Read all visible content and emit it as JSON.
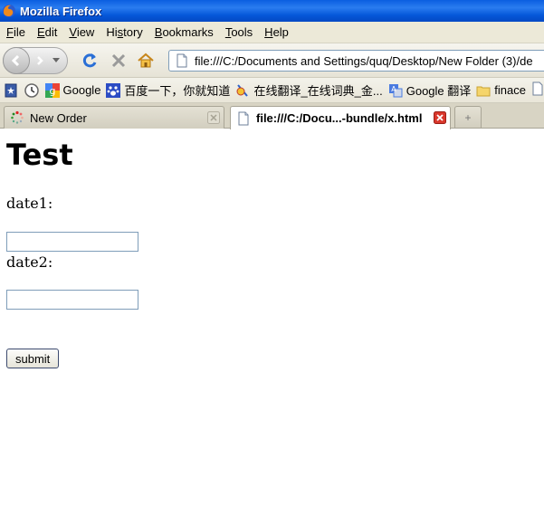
{
  "window": {
    "title": "Mozilla Firefox"
  },
  "menu": [
    "File",
    "Edit",
    "View",
    "History",
    "Bookmarks",
    "Tools",
    "Help"
  ],
  "menu_accel": [
    "F",
    "E",
    "V",
    "s",
    "B",
    "T",
    "H"
  ],
  "address_bar": {
    "url": "file:///C:/Documents and Settings/quq/Desktop/New Folder (3)/de"
  },
  "bookmarks": [
    {
      "label": "Google",
      "icon": "google-icon"
    },
    {
      "label": "百度一下，你就知道",
      "icon": "baidu-paw-icon"
    },
    {
      "label": "在线翻译_在线词典_金...",
      "icon": "iciba-icon"
    },
    {
      "label": "Google 翻译",
      "icon": "google-translate-icon"
    },
    {
      "label": "finace",
      "icon": "folder-icon"
    }
  ],
  "tabs": [
    {
      "label": "New Order",
      "active": false
    },
    {
      "label": "file:///C:/Docu...-bundle/x.html",
      "active": true
    }
  ],
  "page": {
    "heading": "Test",
    "date1_label": "date1:",
    "date1_value": "",
    "date2_label": "date2:",
    "date2_value": "",
    "submit_label": "submit"
  }
}
